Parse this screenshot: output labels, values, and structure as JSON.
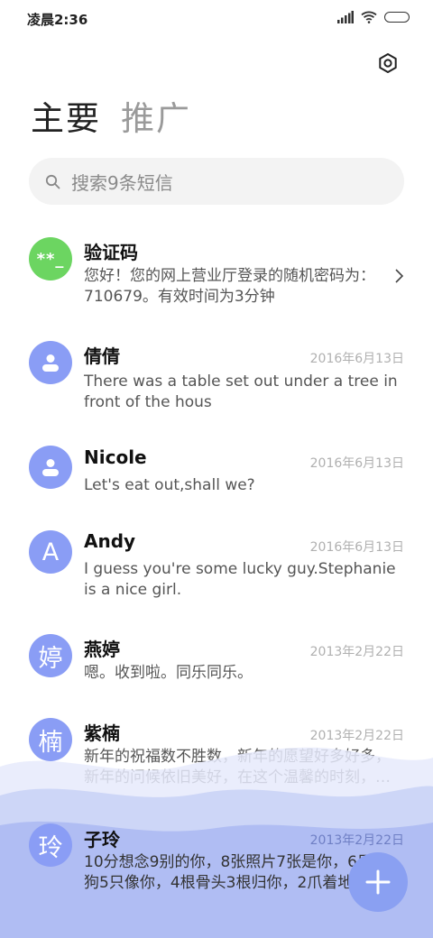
{
  "status_bar": {
    "time": "凌晨2:36"
  },
  "tabs": [
    {
      "label": "主要"
    },
    {
      "label": "推广"
    }
  ],
  "search": {
    "placeholder": "搜索9条短信"
  },
  "messages": [
    {
      "name": "验证码",
      "date": "",
      "preview": "您好！您的网上营业厅登录的随机密码为：710679。有效时间为3分钟",
      "avatar": "**_"
    },
    {
      "name": "倩倩",
      "date": "2016年6月13日",
      "preview": "There was a table set out under a tree in front of the hous",
      "avatar": "person"
    },
    {
      "name": "Nicole",
      "date": "2016年6月13日",
      "preview": "Let's eat out,shall we?",
      "avatar": "person"
    },
    {
      "name": "Andy",
      "date": "2016年6月13日",
      "preview": "I guess you're some lucky guy.Stephanie is a nice girl.",
      "avatar": "A"
    },
    {
      "name": "燕婷",
      "date": "2013年2月22日",
      "preview": "嗯。收到啦。同乐同乐。",
      "avatar": "婷"
    },
    {
      "name": "紫楠",
      "date": "2013年2月22日",
      "preview": "新年的祝福数不胜数，新年的愿望好多好多，新年的问候依旧美好，在这个温馨的时刻，…",
      "avatar": "楠"
    },
    {
      "name": "子玲",
      "date": "2013年2月22日",
      "preview": "10分想念9别的你，8张照片7张是你，6只小狗5只像你，4根骨头3根归你，2爪着地",
      "avatar": "玲"
    }
  ],
  "icons": {
    "settings": "gear-icon",
    "search": "search-icon",
    "signal": "signal-icon",
    "wifi": "wifi-icon",
    "battery": "battery-icon",
    "chevron": "chevron-right-icon",
    "person": "person-icon",
    "fab": "plus-icon"
  },
  "colors": {
    "avatar_blue": "#8a9df5",
    "avatar_green": "#6cd561",
    "fab": "#8aa0f2",
    "wave": "#c9d2f7"
  }
}
